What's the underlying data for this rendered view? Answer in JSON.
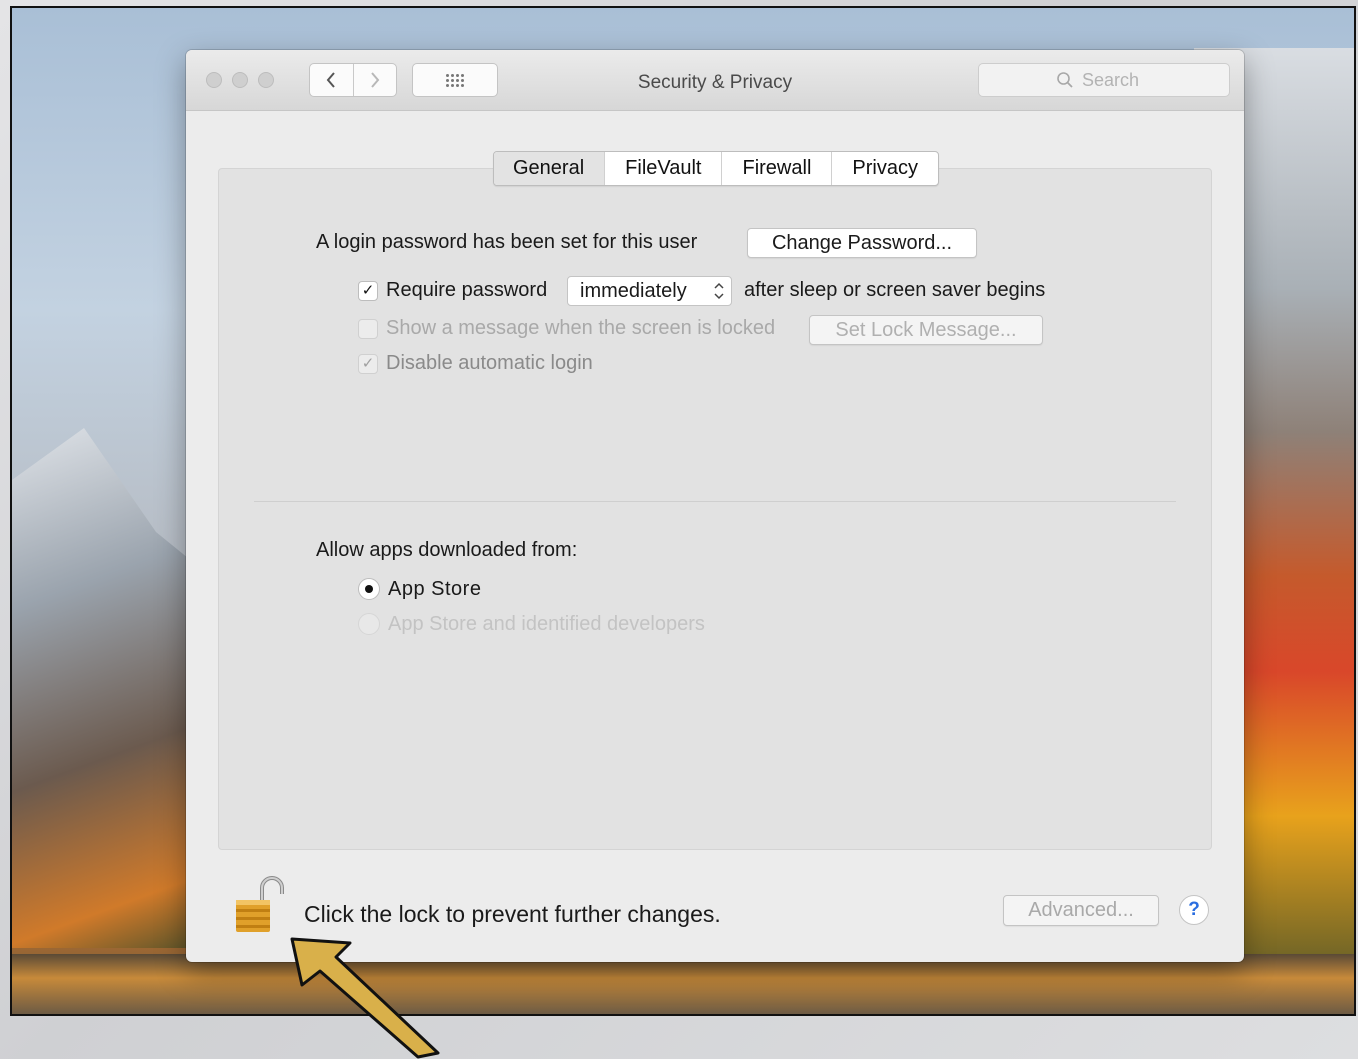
{
  "window": {
    "title": "Security & Privacy",
    "search_placeholder": "Search"
  },
  "tabs": [
    "General",
    "FileVault",
    "Firewall",
    "Privacy"
  ],
  "active_tab": "General",
  "general": {
    "login_text": "A login password has been set for this user",
    "change_password_label": "Change Password...",
    "require_password": {
      "checked": true,
      "label": "Require password",
      "select_value": "immediately",
      "suffix": "after sleep or screen saver begins"
    },
    "show_message": {
      "checked": false,
      "enabled": false,
      "label": "Show a message when the screen is locked",
      "button_label": "Set Lock Message..."
    },
    "disable_auto_login": {
      "checked": true,
      "enabled": false,
      "label": "Disable automatic login"
    },
    "allow_apps_title": "Allow apps downloaded from:",
    "allow_apps_options": [
      {
        "label": "App Store",
        "selected": true,
        "enabled": true
      },
      {
        "label": "App Store and identified developers",
        "selected": false,
        "enabled": false
      }
    ]
  },
  "footer": {
    "lock_text": "Click the lock to prevent further changes.",
    "advanced_label": "Advanced...",
    "help_label": "?"
  },
  "colors": {
    "help_blue": "#2b6ee0",
    "lock_gold": "#e0a02a",
    "annotation_arrow": "#d9b04a"
  },
  "icons": {
    "lock": "padlock-open-icon",
    "search": "magnifier-icon",
    "annotation": "arrow-annotation-icon"
  }
}
